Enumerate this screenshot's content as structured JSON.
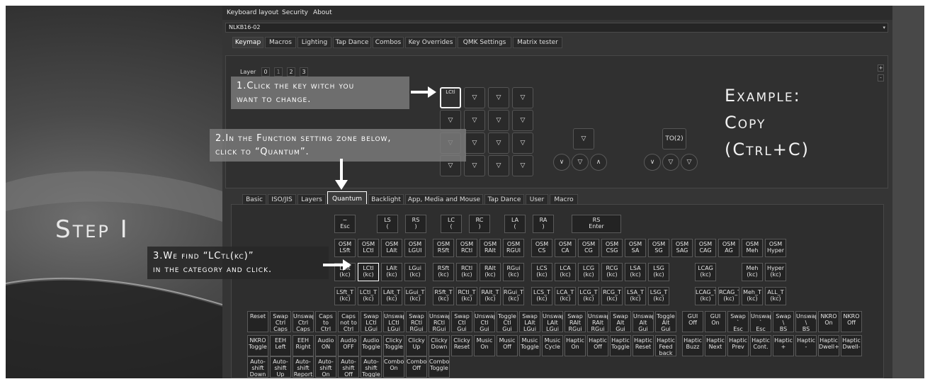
{
  "menubar": [
    "Keyboard layout",
    "Security",
    "About"
  ],
  "device": {
    "name": "NLKB16-02",
    "caret": "▾"
  },
  "main_tabs": [
    {
      "label": "Keymap",
      "active": true
    },
    {
      "label": "Macros"
    },
    {
      "label": "Lighting"
    },
    {
      "label": "Tap Dance"
    },
    {
      "label": "Combos"
    },
    {
      "label": "Key Overrides"
    },
    {
      "label": "QMK Settings"
    },
    {
      "label": "Matrix tester"
    }
  ],
  "layer": {
    "label": "Layer",
    "options": [
      "0",
      "1",
      "2",
      "3"
    ],
    "selected": "1"
  },
  "zoom": {
    "plus": "+",
    "minus": "-"
  },
  "keymap": {
    "selected_key": "LCtl",
    "triangle": "▽",
    "knob_left": "∨",
    "knob_right": "∧",
    "to_key": "TO(2)"
  },
  "func_tabs": [
    {
      "label": "Basic"
    },
    {
      "label": "ISO/JIS"
    },
    {
      "label": "Layers"
    },
    {
      "label": "Quantum",
      "active": true
    },
    {
      "label": "Backlight"
    },
    {
      "label": "App, Media and Mouse"
    },
    {
      "label": "Tap Dance"
    },
    {
      "label": "User"
    },
    {
      "label": "Macro"
    }
  ],
  "quantum_keys": {
    "row1": [
      "~\nEsc",
      "LS\n(",
      "RS\n)",
      "LC\n(",
      "RC\n)",
      "LA\n(",
      "RA\n)",
      "RS\nEnter"
    ],
    "row2": [
      "OSM\nLSft",
      "OSM\nLCtl",
      "OSM\nLAlt",
      "OSM\nLGUI",
      "OSM\nRSft",
      "OSM\nRCtl",
      "OSM\nRAlt",
      "OSM\nRGUI",
      "OSM\nCS",
      "OSM\nCA",
      "OSM\nCG",
      "OSM\nCSG",
      "OSM\nSA",
      "OSM\nSG",
      "OSM\nSAG",
      "OSM\nCAG",
      "OSM\nAG",
      "OSM\nMeh",
      "OSM\nHyper"
    ],
    "row3": [
      "LSft\n(kc)",
      "LCtl\n(kc)",
      "LAlt\n(kc)",
      "LGui\n(kc)",
      "RSft\n(kc)",
      "RCtl\n(kc)",
      "RAlt\n(kc)",
      "RGui\n(kc)",
      "LCS\n(kc)",
      "LCA\n(kc)",
      "LCG\n(kc)",
      "RCG\n(kc)",
      "LSA\n(kc)",
      "LSG\n(kc)",
      "LCAG\n(kc)",
      "Meh\n(kc)",
      "Hyper\n(kc)"
    ],
    "row4": [
      "LSft_T\n(kc)",
      "LCtl_T\n(kc)",
      "LAlt_T\n(kc)",
      "LGui_T\n(kc)",
      "RSft_T\n(kc)",
      "RCtl_T\n(kc)",
      "RAlt_T\n(kc)",
      "RGui_T\n(kc)",
      "LCS_T\n(kc)",
      "LCA_T\n(kc)",
      "LCG_T\n(kc)",
      "RCG_T\n(kc)",
      "LSA_T\n(kc)",
      "LSG_T\n(kc)",
      "LCAG_T\n(kc)",
      "RCAG_T\n(kc)",
      "Meh_T\n(kc)",
      "ALL_T\n(kc)"
    ],
    "row5": [
      "Reset",
      "Swap\nCtrl\nCaps",
      "Unswap\nCtrl\nCaps",
      "Caps\nto\nCtrl",
      "Caps\nnot to\nCtrl",
      "Swap\nLCtl\nLGui",
      "Unswap\nLCtl\nLGui",
      "Swap\nRCtl\nRGui",
      "Unswap\nRCtl\nRGui",
      "Swap\nCtl\nGui",
      "Unswap\nCtl\nGui",
      "Toggle\nCtl\nGui",
      "Swap\nLAlt\nLGui",
      "Unswap\nLAlt\nLGui",
      "Swap\nRAlt\nRGui",
      "Unswap\nRAlt\nRGui",
      "Swap\nAlt\nGui",
      "Unswap\nAlt\nGui",
      "Toggle\nAlt\nGui",
      "GUI\nOff",
      "GUI\nOn",
      "Swap\n`\nEsc",
      "Unswap\n`\nEsc",
      "Swap\n\\\nBS",
      "Unswap\n\\\nBS",
      "NKRO\nOn",
      "NKRO\nOff"
    ],
    "row6": [
      "NKRO\nToggle",
      "EEH\nLeft",
      "EEH\nRight",
      "Audio\nON",
      "Audio\nOFF",
      "Audio\nToggle",
      "Clicky\nToggle",
      "Clicky\nUp",
      "Clicky\nDown",
      "Clicky\nReset",
      "Music\nOn",
      "Music\nOff",
      "Music\nToggle",
      "Music\nCycle",
      "Haptic\nOn",
      "Haptic\nOff",
      "Haptic\nToggle",
      "Haptic\nReset",
      "Haptic\nFeed\nback",
      "Haptic\nBuzz",
      "Haptic\nNext",
      "Haptic\nPrev",
      "Haptic\nCont.",
      "Haptic\n+",
      "Haptic\n-",
      "Haptic\nDwell+",
      "Haptic\nDwell-"
    ],
    "row7": [
      "Auto-\nshift\nDown",
      "Auto-\nshift\nUp",
      "Auto-\nshift\nReport",
      "Auto-\nshift\nOn",
      "Auto-\nshift\nOff",
      "Auto-\nshift\nToggle",
      "Combo\nOn",
      "Combo\nOff",
      "Combo\nToggle"
    ]
  },
  "scroll_up": "▲",
  "annotations": {
    "step1": "1.Click the key witch you\nwant to change.",
    "step2": "2.In the Function setting zone below,\nclick to “Quantum”.",
    "step3": "3.We find “LCtl(kc)”\nin the category and click."
  },
  "step_title": "Step I",
  "example": {
    "title": "Example:",
    "line2": "Copy",
    "line3": "(Ctrl+C)"
  }
}
